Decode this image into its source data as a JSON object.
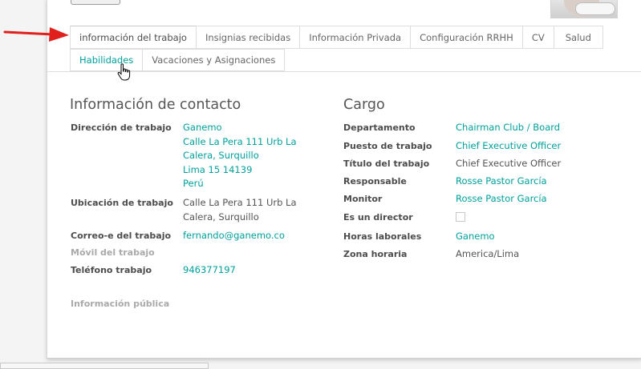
{
  "tabs": {
    "row1": [
      "información del trabajo",
      "Insignias recibidas",
      "Información Privada",
      "Configuración RRHH",
      "CV",
      "Salud"
    ],
    "row2": [
      "Habilidades",
      "Vacaciones y Asignaciones"
    ]
  },
  "contact": {
    "title": "Información de contacto",
    "work_address_label": "Dirección de trabajo",
    "work_address": [
      "Ganemo",
      "Calle La Pera 111 Urb La",
      "Calera, Surquillo",
      "Lima 15 14139",
      "Perú"
    ],
    "work_location_label": "Ubicación de trabajo",
    "work_location": [
      "Calle La Pera 111 Urb La",
      "Calera, Surquillo"
    ],
    "work_email_label": "Correo-e del trabajo",
    "work_email": "fernando@ganemo.co",
    "work_mobile_label": "Móvil del trabajo",
    "work_phone_label": "Teléfono trabajo",
    "work_phone": "946377197",
    "public_info_label": "Información pública"
  },
  "position": {
    "title": "Cargo",
    "department_label": "Departamento",
    "department": "Chairman Club / Board",
    "job_position_label": "Puesto de trabajo",
    "job_position": "Chief Executive Officer",
    "job_title_label": "Título del trabajo",
    "job_title": "Chief Executive Officer",
    "manager_label": "Responsable",
    "manager": "Rosse Pastor García",
    "coach_label": "Monitor",
    "coach": "Rosse Pastor García",
    "is_director_label": "Es un director",
    "working_hours_label": "Horas laborales",
    "working_hours": "Ganemo",
    "timezone_label": "Zona horaria",
    "timezone": "America/Lima"
  },
  "colors": {
    "link": "#00A09D",
    "arrow": "#e0201c"
  },
  "icons": {
    "arrow": "red-arrow-icon",
    "cursor": "hand-pointer-icon"
  }
}
